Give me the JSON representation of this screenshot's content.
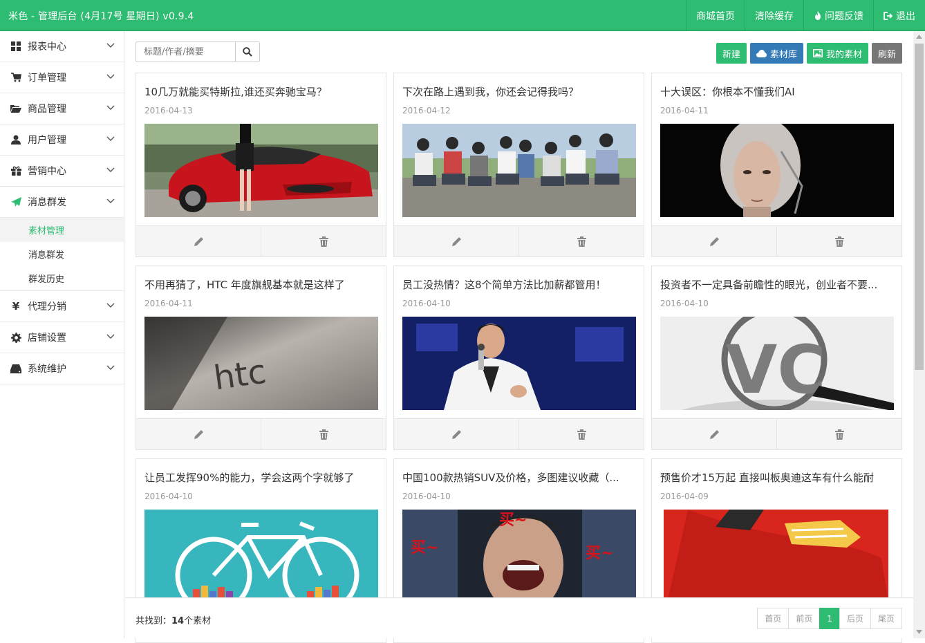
{
  "header": {
    "title": "米色 - 管理后台 (4月17号 星期日) v0.9.4",
    "nav": [
      "商城首页",
      "清除缓存",
      "问题反馈",
      "退出"
    ]
  },
  "sidebar": {
    "items": [
      {
        "label": "报表中心",
        "icon": "dashboard-icon"
      },
      {
        "label": "订单管理",
        "icon": "cart-icon"
      },
      {
        "label": "商品管理",
        "icon": "folder-open-icon"
      },
      {
        "label": "用户管理",
        "icon": "user-icon"
      },
      {
        "label": "营销中心",
        "icon": "gift-icon"
      },
      {
        "label": "消息群发",
        "icon": "send-icon"
      }
    ],
    "submenu": [
      "素材管理",
      "消息群发",
      "群发历史"
    ],
    "items2": [
      {
        "label": "代理分销",
        "icon": "yen-icon"
      },
      {
        "label": "店铺设置",
        "icon": "gear-icon"
      },
      {
        "label": "系统维护",
        "icon": "hdd-icon"
      }
    ]
  },
  "toolbar": {
    "search_placeholder": "标题/作者/摘要",
    "new_label": "新建",
    "library_label": "素材库",
    "my_label": "我的素材",
    "refresh_label": "刷新"
  },
  "colors": {
    "primary": "#2ebb72",
    "blue": "#337ab7",
    "gray": "#777777"
  },
  "articles": [
    {
      "title": "10几万就能买特斯拉,谁还买奔驰宝马？",
      "date": "2016-04-13"
    },
    {
      "title": "下次在路上遇到我，你还会记得我吗？",
      "date": "2016-04-12"
    },
    {
      "title": "十大误区：你根本不懂我们AI",
      "date": "2016-04-11"
    },
    {
      "title": "不用再猜了，HTC 年度旗舰基本就是这样了",
      "date": "2016-04-11"
    },
    {
      "title": "员工没热情？这8个简单方法比加薪都管用！",
      "date": "2016-04-10"
    },
    {
      "title": "投资者不一定具备前瞻性的眼光，创业者不要...",
      "date": "2016-04-10"
    },
    {
      "title": "让员工发挥90%的能力，学会这两个字就够了",
      "date": "2016-04-10"
    },
    {
      "title": "中国100款热销SUV及价格，多图建议收藏（...",
      "date": "2016-04-10"
    },
    {
      "title": "预售价才15万起 直接叫板奥迪这车有什么能耐",
      "date": "2016-04-09"
    }
  ],
  "image_text": {
    "htc": "htc",
    "vc": "VC",
    "buy": "买~"
  },
  "footer": {
    "prefix": "共找到：",
    "count": "14",
    "suffix": "个素材"
  },
  "pager": [
    "首页",
    "前页",
    "1",
    "后页",
    "尾页"
  ]
}
